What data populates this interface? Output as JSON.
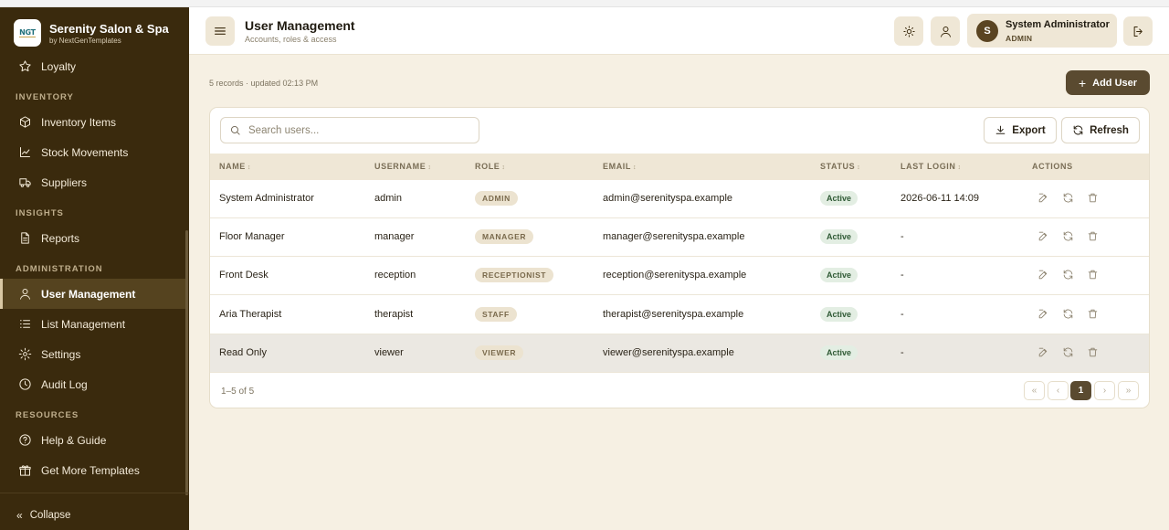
{
  "brand": {
    "logo_text": "NGT",
    "name": "Serenity Salon & Spa",
    "sub": "by NextGenTemplates"
  },
  "sidebar": {
    "loyalty": "Loyalty",
    "sections": {
      "inventory": "INVENTORY",
      "insights": "INSIGHTS",
      "administration": "ADMINISTRATION",
      "resources": "RESOURCES"
    },
    "items": {
      "inventory_items": "Inventory Items",
      "stock_movements": "Stock Movements",
      "suppliers": "Suppliers",
      "reports": "Reports",
      "user_management": "User Management",
      "list_management": "List Management",
      "settings": "Settings",
      "audit_log": "Audit Log",
      "help_guide": "Help & Guide",
      "get_more_templates": "Get More Templates"
    },
    "collapse": "Collapse",
    "collapse_icon": "«"
  },
  "header": {
    "title": "User Management",
    "subtitle": "Accounts, roles & access",
    "user": {
      "initial": "S",
      "name": "System Administrator",
      "role": "ADMIN"
    }
  },
  "main": {
    "records_text": "5 records · updated 02:13 PM",
    "add_user_label": "Add User",
    "add_user_icon": "+",
    "search_placeholder": "Search users...",
    "export_label": "Export",
    "refresh_label": "Refresh",
    "columns": {
      "name": "NAME",
      "username": "USERNAME",
      "role": "ROLE",
      "email": "EMAIL",
      "status": "STATUS",
      "last_login": "LAST LOGIN",
      "actions": "ACTIONS",
      "sort_icon": "↕"
    },
    "rows": [
      {
        "name": "System Administrator",
        "username": "admin",
        "role": "ADMIN",
        "email": "admin@serenityspa.example",
        "status": "Active",
        "last_login": "2026-06-11 14:09"
      },
      {
        "name": "Floor Manager",
        "username": "manager",
        "role": "MANAGER",
        "email": "manager@serenityspa.example",
        "status": "Active",
        "last_login": "-"
      },
      {
        "name": "Front Desk",
        "username": "reception",
        "role": "RECEPTIONIST",
        "email": "reception@serenityspa.example",
        "status": "Active",
        "last_login": "-"
      },
      {
        "name": "Aria Therapist",
        "username": "therapist",
        "role": "STAFF",
        "email": "therapist@serenityspa.example",
        "status": "Active",
        "last_login": "-"
      },
      {
        "name": "Read Only",
        "username": "viewer",
        "role": "VIEWER",
        "email": "viewer@serenityspa.example",
        "status": "Active",
        "last_login": "-"
      }
    ],
    "range_text": "1–5 of 5",
    "pagination": {
      "first": "«",
      "prev": "‹",
      "current": "1",
      "next": "›",
      "last": "»"
    }
  },
  "colors": {
    "sidebar_bg": "#3a2a0d",
    "accent": "#5a4a30",
    "page_bg": "#f6f0e3",
    "active_status": "#2f5a35"
  },
  "icons": [
    "star-icon",
    "box-icon",
    "chart-line-icon",
    "truck-icon",
    "file-icon",
    "user-icon",
    "list-icon",
    "gear-icon",
    "clock-icon",
    "help-circle-icon",
    "gift-icon",
    "menu-icon",
    "sun-icon",
    "logout-icon",
    "search-icon",
    "download-icon",
    "refresh-icon",
    "edit-icon",
    "trash-icon"
  ]
}
